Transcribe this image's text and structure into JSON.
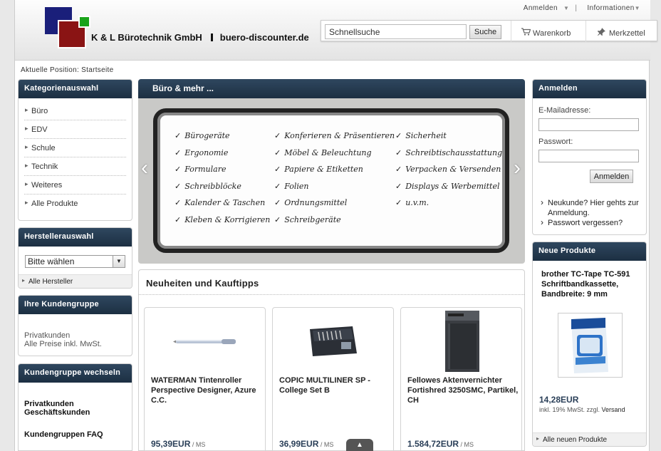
{
  "header": {
    "brand": "K & L Bürotechnik GmbH",
    "domain": "buero-discounter.de",
    "topnav": {
      "login": "Anmelden",
      "info": "Informationen"
    },
    "search": {
      "value": "Schnellsuche",
      "button": "Suche"
    },
    "cart": "Warenkorb",
    "wishlist": "Merkzettel"
  },
  "breadcrumb": "Aktuelle Position: Startseite",
  "categories": {
    "title": "Kategorienauswahl",
    "items": [
      "Büro",
      "EDV",
      "Schule",
      "Technik",
      "Weiteres",
      "Alle Produkte"
    ]
  },
  "manufacturers": {
    "title": "Herstellerauswahl",
    "selected": "Bitte wählen",
    "all_link": "Alle Hersteller"
  },
  "customer_group": {
    "title": "Ihre Kundengruppe",
    "line1": "Privatkunden",
    "line2": "Alle Preise inkl. MwSt."
  },
  "switch_group": {
    "title": "Kundengruppe wechseln",
    "private": "Privatkunden",
    "business": "Geschäftskunden",
    "faq": "Kundengruppen FAQ"
  },
  "slider": {
    "title": "Büro & mehr ...",
    "col1": [
      "Bürogeräte",
      "Ergonomie",
      "Formulare",
      "Schreibblöcke",
      "Kalender & Taschen",
      "Kleben & Korrigieren"
    ],
    "col2": [
      "Konferieren & Präsentieren",
      "Möbel & Beleuchtung",
      "Papiere & Etiketten",
      "Folien",
      "Ordnungsmittel",
      "Schreibgeräte"
    ],
    "col3": [
      "Sicherheit",
      "Schreibtischausstattung",
      "Verpacken & Versenden",
      "Displays & Werbemittel",
      "u.v.m."
    ]
  },
  "news": {
    "title": "Neuheiten und Kauftipps",
    "products": [
      {
        "name": "WATERMAN Tintenroller Perspective Designer, Azure C.C.",
        "price": "95,39EUR",
        "unit": " / MS"
      },
      {
        "name": "COPIC MULTILINER SP - College Set B",
        "price": "36,99EUR",
        "unit": " / MS"
      },
      {
        "name": "Fellowes Aktenvernichter Fortishred 3250SMC, Partikel, CH",
        "price": "1.584,72EUR",
        "unit": " / MS"
      }
    ]
  },
  "login": {
    "title": "Anmelden",
    "email_label": "E-Mailadresse:",
    "password_label": "Passwort:",
    "button": "Anmelden",
    "new_customer": "Neukunde? Hier gehts zur Anmeldung.",
    "forgot": "Passwort vergessen?"
  },
  "new_products": {
    "title": "Neue Produkte",
    "name": "brother TC-Tape TC-591 Schriftbandkassette, Bandbreite: 9 mm",
    "price": "14,28EUR",
    "tax": "inkl. 19% MwSt. zzgl.",
    "shipping": "Versand",
    "all_link": "Alle neuen Produkte"
  }
}
